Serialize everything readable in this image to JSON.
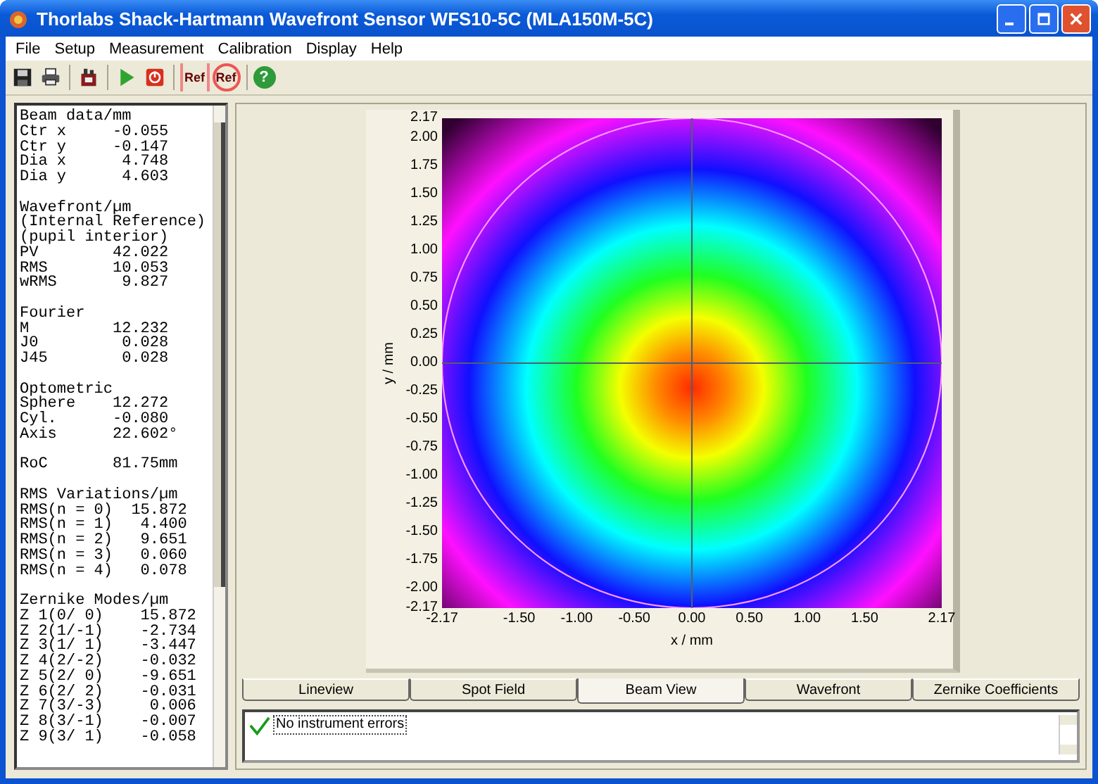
{
  "window": {
    "title": "Thorlabs Shack-Hartmann Wavefront Sensor WFS10-5C (MLA150M-5C)"
  },
  "menu": [
    "File",
    "Setup",
    "Measurement",
    "Calibration",
    "Display",
    "Help"
  ],
  "toolbar": [
    [
      {
        "kind": "save"
      },
      {
        "kind": "print"
      }
    ],
    [
      {
        "kind": "instrument"
      }
    ],
    [
      {
        "kind": "start"
      },
      {
        "kind": "stop"
      }
    ],
    [
      {
        "kind": "ref-grid",
        "label": "Ref"
      },
      {
        "kind": "ref-target",
        "label": "Ref"
      }
    ],
    [
      {
        "kind": "help",
        "label": "?"
      }
    ]
  ],
  "readout": [
    {
      "headings": [
        "Beam data/mm"
      ],
      "rows": [
        {
          "label": "Ctr x",
          "value": "-0.055"
        },
        {
          "label": "Ctr y",
          "value": "-0.147"
        },
        {
          "label": "Dia x",
          "value": " 4.748"
        },
        {
          "label": "Dia y",
          "value": " 4.603"
        }
      ]
    },
    {
      "headings": [
        "Wavefront/µm",
        "(Internal Reference)",
        "(pupil interior)"
      ],
      "rows": [
        {
          "label": "PV",
          "value": "42.022"
        },
        {
          "label": "RMS",
          "value": "10.053"
        },
        {
          "label": "wRMS",
          "value": " 9.827"
        }
      ]
    },
    {
      "headings": [
        "Fourier"
      ],
      "rows": [
        {
          "label": "M",
          "value": "12.232"
        },
        {
          "label": "J0",
          "value": " 0.028"
        },
        {
          "label": "J45",
          "value": " 0.028"
        }
      ]
    },
    {
      "headings": [
        "Optometric"
      ],
      "rows": [
        {
          "label": "Sphere",
          "value": "12.272"
        },
        {
          "label": "Cyl.",
          "value": "-0.080"
        },
        {
          "label": "Axis",
          "value": "22.602°"
        }
      ]
    },
    {
      "rows": [
        {
          "label": "RoC",
          "value": "81.75mm"
        }
      ]
    },
    {
      "headings": [
        "RMS Variations/µm"
      ],
      "rows": [
        {
          "label": "RMS(n = 0)",
          "value": "  15.872"
        },
        {
          "label": "RMS(n = 1)",
          "value": "   4.400"
        },
        {
          "label": "RMS(n = 2)",
          "value": "   9.651"
        },
        {
          "label": "RMS(n = 3)",
          "value": "   0.060"
        },
        {
          "label": "RMS(n = 4)",
          "value": "   0.078"
        }
      ]
    },
    {
      "headings": [
        "Zernike Modes/µm"
      ],
      "rows": [
        {
          "label": "Z 1(0/ 0)",
          "value": "   15.872"
        },
        {
          "label": "Z 2(1/-1)",
          "value": "   -2.734"
        },
        {
          "label": "Z 3(1/ 1)",
          "value": "   -3.447"
        },
        {
          "label": "Z 4(2/-2)",
          "value": "   -0.032"
        },
        {
          "label": "Z 5(2/ 0)",
          "value": "   -9.651"
        },
        {
          "label": "Z 6(2/ 2)",
          "value": "   -0.031"
        },
        {
          "label": "Z 7(3/-3)",
          "value": "    0.006"
        },
        {
          "label": "Z 8(3/-1)",
          "value": "   -0.007"
        },
        {
          "label": "Z 9(3/ 1)",
          "value": "   -0.058"
        }
      ]
    }
  ],
  "beam_view": {
    "ylabel": "y / mm",
    "xlabel": "x / mm",
    "yticks": [
      "2.17",
      "2.00",
      "1.75",
      "1.50",
      "1.25",
      "1.00",
      "0.75",
      "0.50",
      "0.25",
      "0.00",
      "-0.25",
      "-0.50",
      "-0.75",
      "-1.00",
      "-1.25",
      "-1.50",
      "-1.75",
      "-2.00",
      "-2.17"
    ],
    "xticks": [
      "-2.17",
      "-1.50",
      "-1.00",
      "-0.50",
      "0.00",
      "0.50",
      "1.00",
      "1.50",
      "2.17"
    ]
  },
  "tabs": [
    {
      "label": "Lineview",
      "selected": false
    },
    {
      "label": "Spot Field",
      "selected": false
    },
    {
      "label": "Beam View",
      "selected": true
    },
    {
      "label": "Wavefront",
      "selected": false
    },
    {
      "label": "Zernike Coefficients",
      "selected": false
    }
  ],
  "status": {
    "ok": true,
    "message": "No instrument errors"
  }
}
